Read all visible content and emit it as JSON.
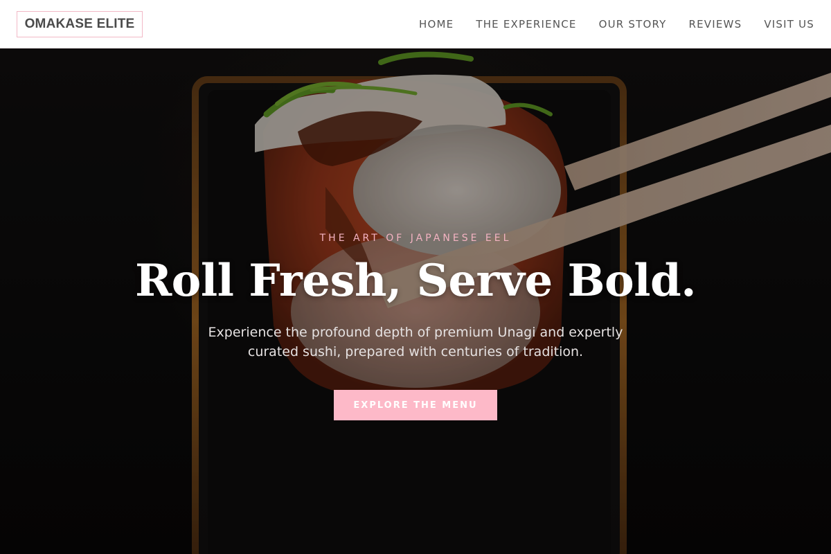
{
  "brand": {
    "name": "OMAKASE ELITE",
    "accent_color": "#fdb9c8",
    "border_color": "#f2b8c6"
  },
  "nav": {
    "items": [
      {
        "label": "HOME"
      },
      {
        "label": "THE EXPERIENCE"
      },
      {
        "label": "OUR STORY"
      },
      {
        "label": "REVIEWS"
      },
      {
        "label": "VISIT US"
      }
    ]
  },
  "hero": {
    "eyebrow": "THE ART OF JAPANESE EEL",
    "title": "Roll Fresh, Serve Bold.",
    "subtitle": "Experience the profound depth of premium Unagi and expertly curated sushi, prepared with centuries of tradition.",
    "cta_label": "EXPLORE THE MENU",
    "background_image": "sushi-roll-with-chopsticks-photo"
  }
}
